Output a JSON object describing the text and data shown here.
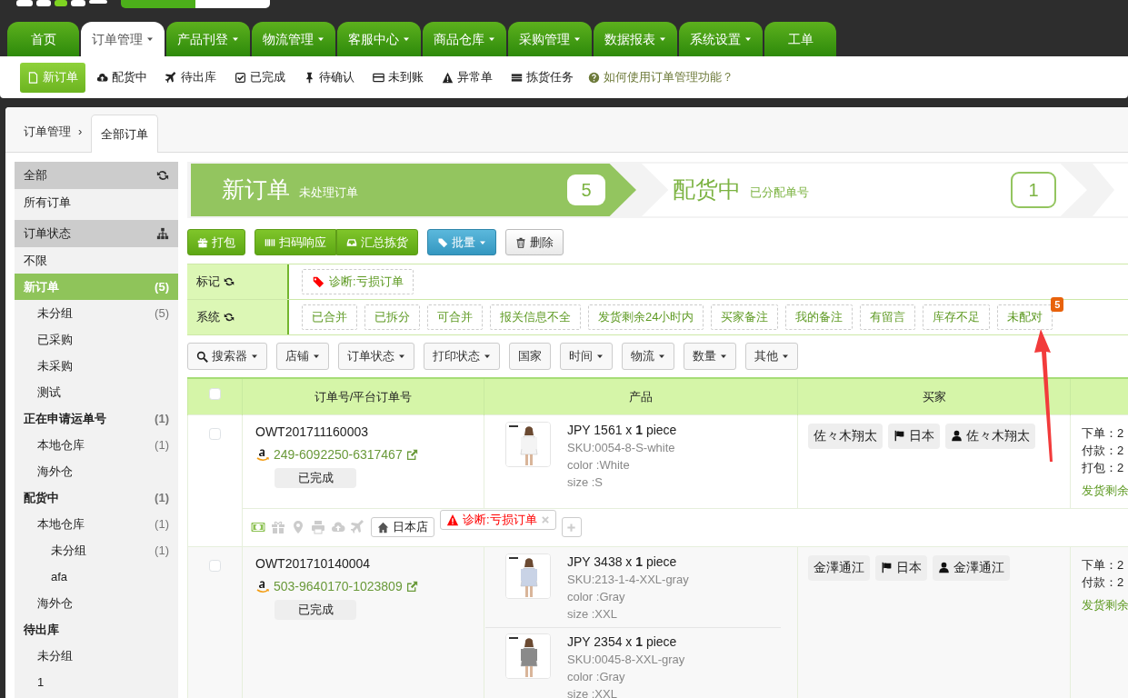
{
  "mode_switch": [
    {
      "selected": true
    },
    {
      "selected": false
    }
  ],
  "top_tabs": [
    {
      "label": "首页",
      "dropdown": false,
      "selected": false
    },
    {
      "label": "订单管理",
      "dropdown": true,
      "selected": true
    },
    {
      "label": "产品刊登",
      "dropdown": true,
      "selected": false
    },
    {
      "label": "物流管理",
      "dropdown": true,
      "selected": false
    },
    {
      "label": "客服中心",
      "dropdown": true,
      "selected": false
    },
    {
      "label": "商品仓库",
      "dropdown": true,
      "selected": false
    },
    {
      "label": "采购管理",
      "dropdown": true,
      "selected": false
    },
    {
      "label": "数据报表",
      "dropdown": true,
      "selected": false
    },
    {
      "label": "系统设置",
      "dropdown": true,
      "selected": false
    },
    {
      "label": "工单",
      "dropdown": false,
      "selected": false
    }
  ],
  "subnav": {
    "items": [
      {
        "label": "新订单",
        "kind": "new",
        "selected": true
      },
      {
        "label": "配货中",
        "kind": "allocating",
        "selected": false
      },
      {
        "label": "待出库",
        "kind": "outbound",
        "selected": false
      },
      {
        "label": "已完成",
        "kind": "done",
        "selected": false
      },
      {
        "label": "待确认",
        "kind": "confirm",
        "selected": false
      },
      {
        "label": "未到账",
        "kind": "unpaid",
        "selected": false
      },
      {
        "label": "异常单",
        "kind": "exception",
        "selected": false
      },
      {
        "label": "拣货任务",
        "kind": "picking",
        "selected": false
      }
    ],
    "help": "如何使用订单管理功能？"
  },
  "breadcrumb": {
    "items": [
      {
        "label": "订单管理",
        "separator": "›"
      }
    ],
    "tab": "全部订单"
  },
  "sidebar": {
    "sections": [
      {
        "title": "全部",
        "kind": "all",
        "items": [
          {
            "label": "所有订单",
            "selected": false
          }
        ]
      },
      {
        "title": "订单状态",
        "kind": "status",
        "items": [
          {
            "label": "不限",
            "selected": false
          },
          {
            "label": "新订单",
            "count": "(5)",
            "selected": true,
            "children": [
              {
                "label": "未分组",
                "count": "(5)",
                "selected": false
              },
              {
                "label": "已采购",
                "selected": false
              },
              {
                "label": "未采购",
                "selected": false
              },
              {
                "label": "测试",
                "selected": false
              }
            ]
          },
          {
            "label": "正在申请运单号",
            "count": "(1)",
            "selected": false,
            "children": [
              {
                "label": "本地仓库",
                "count": "(1)",
                "selected": false
              },
              {
                "label": "海外仓",
                "selected": false
              }
            ]
          },
          {
            "label": "配货中",
            "count": "(1)",
            "selected": false,
            "children": [
              {
                "label": "本地仓库",
                "count": "(1)",
                "selected": false,
                "children": [
                  {
                    "label": "未分组",
                    "count": "(1)",
                    "selected": false
                  },
                  {
                    "label": "afa",
                    "selected": false
                  }
                ]
              },
              {
                "label": "海外仓",
                "selected": false
              }
            ]
          },
          {
            "label": "待出库",
            "selected": false,
            "children": [
              {
                "label": "未分组",
                "selected": false
              },
              {
                "label": "1",
                "selected": false
              }
            ]
          }
        ]
      }
    ]
  },
  "steps": [
    {
      "title": "新订单",
      "subtitle": "未处理订单",
      "count": "5",
      "selected": true
    },
    {
      "title": "配货中",
      "subtitle": "已分配单号",
      "count": "1",
      "selected": false
    }
  ],
  "actions": [
    [
      {
        "label": "打包",
        "kind": "pack",
        "dropdown": false
      }
    ],
    [
      {
        "label": "扫码响应",
        "kind": "scan",
        "dropdown": false
      },
      {
        "label": "汇总拣货",
        "kind": "summary",
        "dropdown": false
      }
    ],
    [
      {
        "label": "批量",
        "kind": "batch",
        "dropdown": true
      }
    ],
    [
      {
        "label": "删除",
        "kind": "delete",
        "dropdown": false
      }
    ]
  ],
  "filter_rows": [
    {
      "label": "标记",
      "tags": [
        {
          "label": "诊断:亏损订单",
          "kind": "diagnosis"
        }
      ]
    },
    {
      "label": "系统",
      "tags": [
        {
          "label": "已合并"
        },
        {
          "label": "已拆分"
        },
        {
          "label": "可合并"
        },
        {
          "label": "报关信息不全"
        },
        {
          "label": "发货剩余24小时内"
        },
        {
          "label": "买家备注"
        },
        {
          "label": "我的备注"
        },
        {
          "label": "有留言"
        },
        {
          "label": "库存不足"
        },
        {
          "label": "未配对",
          "badge": "5"
        }
      ]
    }
  ],
  "filter_dropdowns": [
    {
      "label": "搜索器",
      "kind": "search",
      "dropdown": true
    },
    {
      "label": "店铺",
      "dropdown": true
    },
    {
      "label": "订单状态",
      "dropdown": true
    },
    {
      "label": "打印状态",
      "dropdown": true
    },
    {
      "label": "国家",
      "dropdown": false
    },
    {
      "label": "时间",
      "dropdown": true
    },
    {
      "label": "物流",
      "dropdown": true
    },
    {
      "label": "数量",
      "dropdown": true
    },
    {
      "label": "其他",
      "dropdown": true
    }
  ],
  "table": {
    "select_all": {
      "checked": false
    },
    "columns": [
      {
        "label": "订单号/平台订单号"
      },
      {
        "label": "产品"
      },
      {
        "label": "买家"
      }
    ],
    "rows": [
      {
        "checked": false,
        "order_no": "OWT201711160003",
        "platform_order": "249-6092250-6317467",
        "status": "已完成",
        "products": [
          {
            "price": "JPY 1561 x **1** piece",
            "sku": "SKU:0054-8-S-white",
            "options": [
              "color :White",
              "size :S"
            ]
          }
        ],
        "buyer_tags": [
          {
            "label": "佐々木翔太",
            "kind": "name"
          },
          {
            "label": "日本",
            "kind": "country"
          },
          {
            "label": "佐々木翔太",
            "kind": "buyer"
          }
        ],
        "times": [
          "下单：2",
          "付款：2",
          "打包：2"
        ],
        "remaining": "发货剩余",
        "footer": {
          "icons": [
            {
              "kind": "money",
              "on": true
            },
            {
              "kind": "gift",
              "on": false
            },
            {
              "kind": "location",
              "on": false
            },
            {
              "kind": "print",
              "on": false
            },
            {
              "kind": "upload",
              "on": false
            },
            {
              "kind": "plane",
              "on": false
            }
          ],
          "tags": [
            {
              "label": "日本店",
              "kind": "store",
              "removable": false
            },
            {
              "label": "诊断:亏损订单",
              "kind": "alert",
              "removable": true
            }
          ],
          "add": true
        }
      },
      {
        "checked": false,
        "order_no": "OWT201710140004",
        "platform_order": "503-9640170-1023809",
        "status": "已完成",
        "products": [
          {
            "price": "JPY 3438 x **1** piece",
            "sku": "SKU:213-1-4-XXL-gray",
            "options": [
              "color :Gray",
              "size :XXL"
            ]
          },
          {
            "price": "JPY 2354 x **1** piece",
            "sku": "SKU:0045-8-XXL-gray",
            "options": [
              "color :Gray",
              "size :XXL"
            ]
          }
        ],
        "buyer_tags": [
          {
            "label": "金澤通江",
            "kind": "name"
          },
          {
            "label": "日本",
            "kind": "country"
          },
          {
            "label": "金澤通江",
            "kind": "buyer"
          }
        ],
        "times": [
          "下单：2",
          "付款：2"
        ],
        "remaining": "发货剩余"
      }
    ]
  },
  "annotation": {
    "kind": "arrow"
  }
}
